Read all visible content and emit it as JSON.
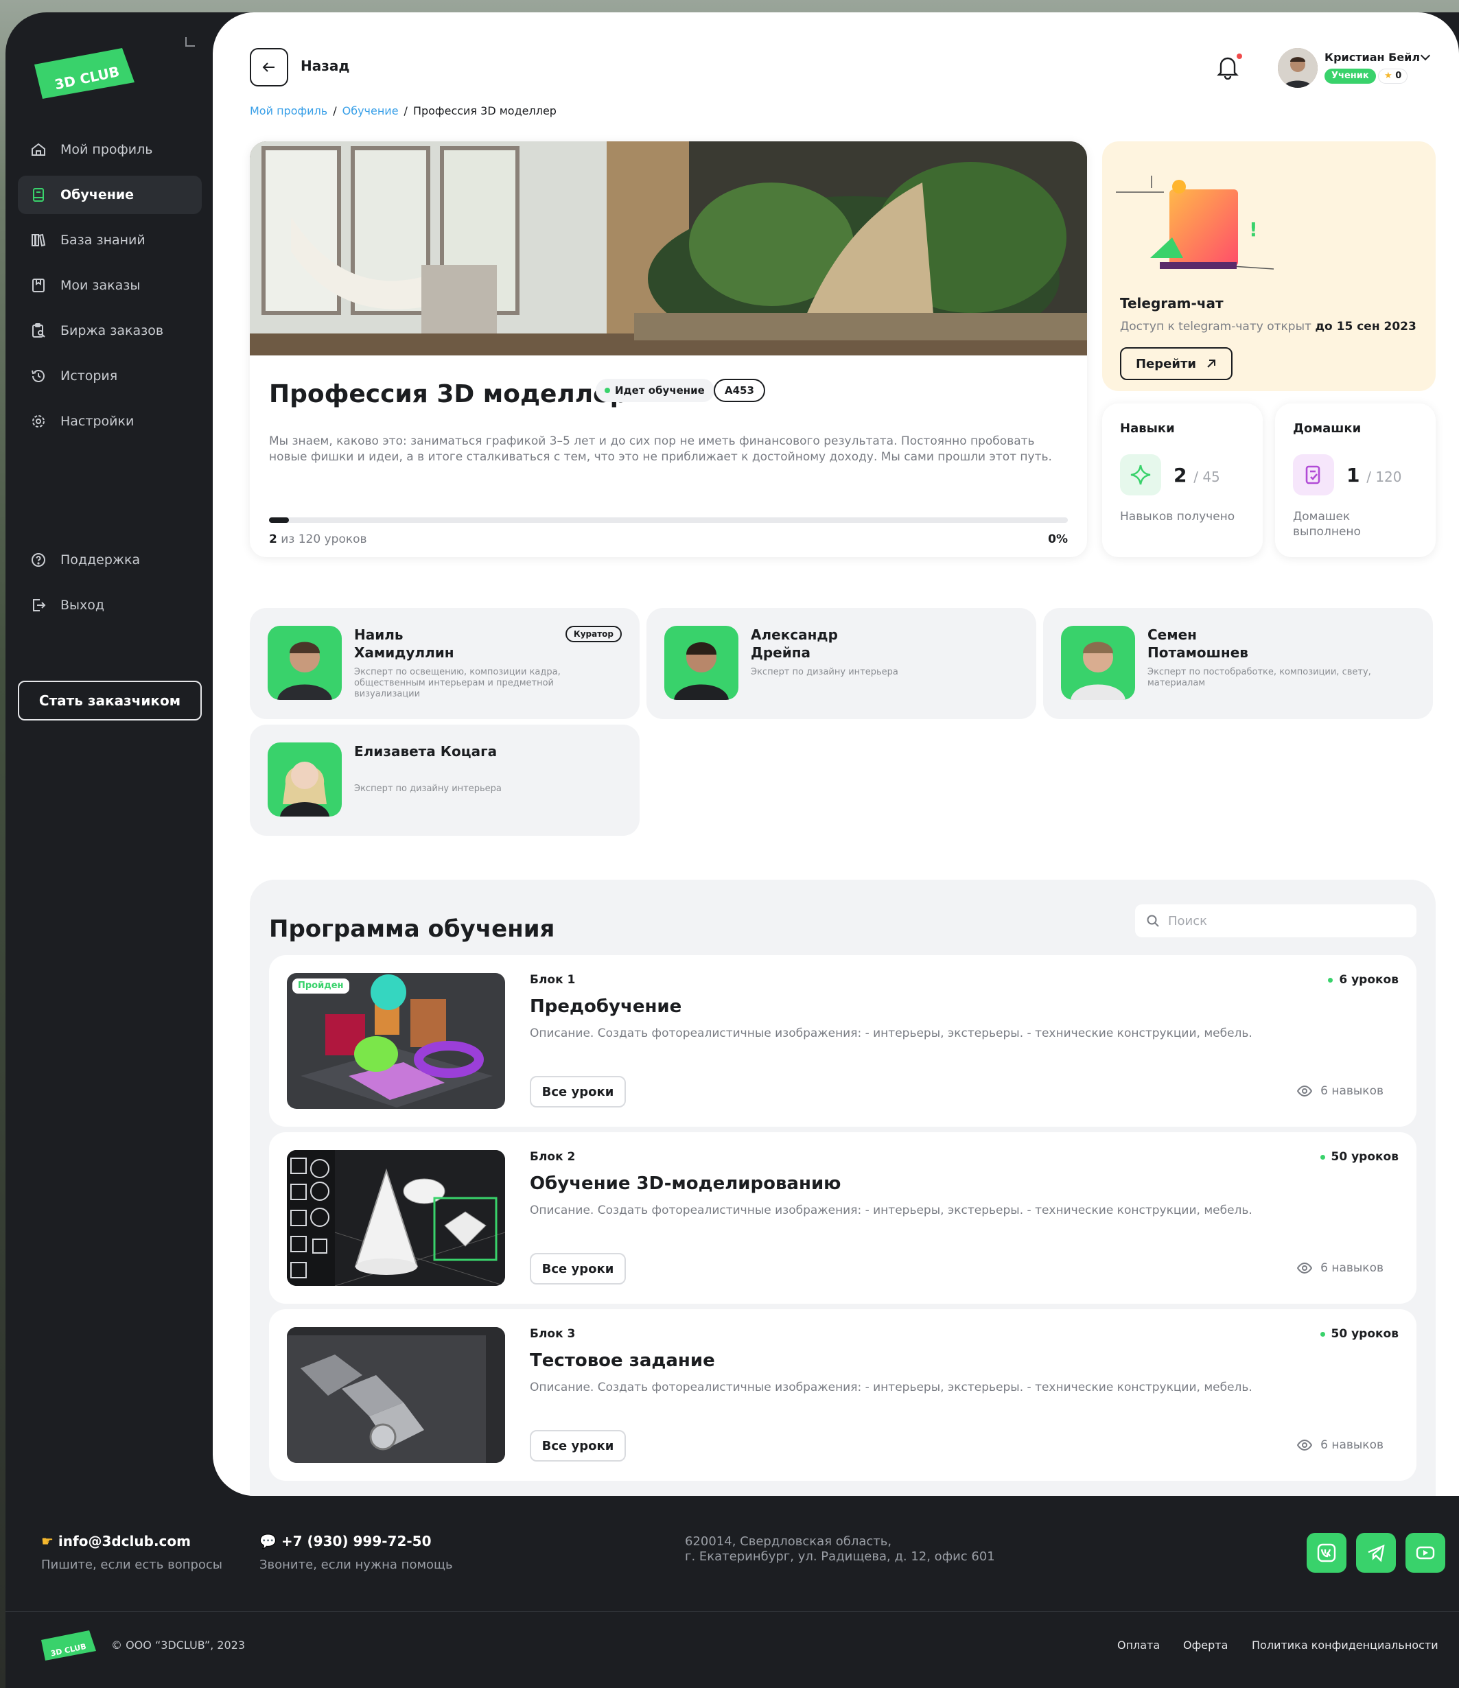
{
  "logo": {
    "text": "3D CLUB"
  },
  "sidebar": {
    "items": [
      {
        "label": "Мой профиль",
        "icon": "home-icon"
      },
      {
        "label": "Обучение",
        "icon": "book-icon",
        "active": true
      },
      {
        "label": "База знаний",
        "icon": "library-icon"
      },
      {
        "label": "Мои заказы",
        "icon": "orders-icon"
      },
      {
        "label": "Биржа заказов",
        "icon": "exchange-icon"
      },
      {
        "label": "История",
        "icon": "history-icon"
      },
      {
        "label": "Настройки",
        "icon": "gear-icon"
      }
    ],
    "bottom_items": [
      {
        "label": "Поддержка",
        "icon": "help-icon"
      },
      {
        "label": "Выход",
        "icon": "logout-icon"
      }
    ],
    "become_button": "Стать заказчиком"
  },
  "header": {
    "back_label": "Назад",
    "user": {
      "name": "Кристиан Бейл",
      "role": "Ученик",
      "points": "0"
    }
  },
  "breadcrumb": {
    "items": [
      "Мой профиль",
      "Обучение",
      "Профессия 3D моделлер"
    ]
  },
  "course": {
    "title": "Профессия 3D моделлер",
    "status": "Идет обучение",
    "code": "A453",
    "description": "Мы знаем, каково это: заниматься графикой 3–5 лет и до сих пор не иметь финансового результата. Постоянно пробовать новые фишки и идеи, а в итоге сталкиваться с тем, что это не приближает к достойному доходу. Мы сами прошли этот путь.",
    "progress_done": "2",
    "progress_text": "из 120 уроков",
    "progress_percent": "0%",
    "progress_fraction": 0.025
  },
  "telegram": {
    "title": "Telegram-чат",
    "text": "Доступ к telegram-чату открыт",
    "until": "до 15 сен 2023",
    "button": "Перейти"
  },
  "stats": [
    {
      "title": "Навыки",
      "value": "2",
      "total": "/ 45",
      "label": "Навыков получено",
      "icon": "sparkle-icon",
      "color": "#39d26b",
      "bg": "#e6f8ec"
    },
    {
      "title": "Домашки",
      "value": "1",
      "total": "/ 120",
      "label": "Домашек выполнено",
      "icon": "homework-icon",
      "color": "#b14bd6",
      "bg": "#f6e6fb"
    }
  ],
  "experts": [
    {
      "name": "Наиль Хамидуллин",
      "role": "Эксперт по освещению, композиции кадра, общественным интерьерам и предметной визуализации",
      "badge": "Куратор"
    },
    {
      "name": "Александр Дрейпа",
      "role": "Эксперт по дизайну интерьера",
      "badge": ""
    },
    {
      "name": "Семен Потамошнев",
      "role": "Эксперт по постобработке, композиции, свету, материалам",
      "badge": ""
    },
    {
      "name": "Елизавета Коцага",
      "role": "Эксперт по дизайну интерьера",
      "badge": ""
    }
  ],
  "program": {
    "title": "Программа обучения",
    "search_placeholder": "Поиск",
    "blocks": [
      {
        "num": "Блок 1",
        "title": "Предобучение",
        "desc": "Описание. Создать фотореалистичные изображения: - интерьеры, экстерьеры. - технические конструкции, мебель.",
        "lessons": "6 уроков",
        "button": "Все уроки",
        "skills": "6 навыков",
        "passed": "Пройден"
      },
      {
        "num": "Блок 2",
        "title": "Обучение 3D-моделированию",
        "desc": "Описание. Создать фотореалистичные изображения: - интерьеры, экстерьеры. - технические конструкции, мебель.",
        "lessons": "50 уроков",
        "button": "Все уроки",
        "skills": "6 навыков",
        "passed": ""
      },
      {
        "num": "Блок 3",
        "title": "Тестовое задание",
        "desc": "Описание. Создать фотореалистичные изображения: - интерьеры, экстерьеры. - технические конструкции, мебель.",
        "lessons": "50 уроков",
        "button": "Все уроки",
        "skills": "6 навыков",
        "passed": ""
      }
    ]
  },
  "footer": {
    "email": "info@3dclub.com",
    "email_sub": "Пишите, если есть вопросы",
    "phone": "+7 (930) 999-72-50",
    "phone_sub": "Звоните, если нужна помощь",
    "address_line1": "620014, Свердловская область,",
    "address_line2": "г. Екатеринбург, ул. Радищева, д. 12, офис 601",
    "socials": [
      "vk-icon",
      "telegram-icon",
      "youtube-icon"
    ],
    "copyright": "© ООО “3DCLUB”, 2023",
    "links": [
      "Оплата",
      "Оферта",
      "Политика конфиденциальности"
    ]
  },
  "colors": {
    "accent": "#39d26b",
    "dark": "#1c1e22",
    "link": "#3aa0e8",
    "telegram_bg": "#fef4df"
  }
}
